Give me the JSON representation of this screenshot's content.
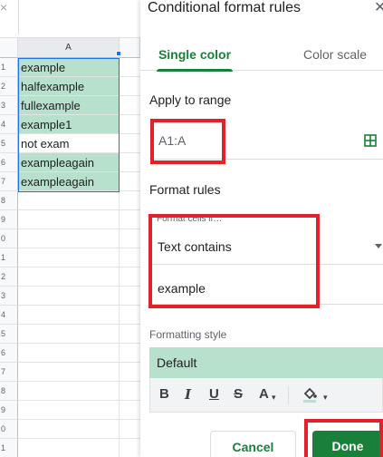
{
  "sheet": {
    "column_header": "A",
    "rows": [
      {
        "num": "1",
        "value": "example",
        "highlight": true
      },
      {
        "num": "2",
        "value": "halfexample",
        "highlight": true
      },
      {
        "num": "3",
        "value": "fullexample",
        "highlight": true
      },
      {
        "num": "4",
        "value": "example1",
        "highlight": true
      },
      {
        "num": "5",
        "value": "not exam",
        "highlight": false
      },
      {
        "num": "6",
        "value": "exampleagain",
        "highlight": true
      },
      {
        "num": "7",
        "value": "exampleagain",
        "highlight": true
      },
      {
        "num": "8",
        "value": "",
        "highlight": false
      },
      {
        "num": "9",
        "value": "",
        "highlight": false
      },
      {
        "num": "0",
        "value": "",
        "highlight": false
      },
      {
        "num": "1",
        "value": "",
        "highlight": false
      },
      {
        "num": "2",
        "value": "",
        "highlight": false
      },
      {
        "num": "3",
        "value": "",
        "highlight": false
      },
      {
        "num": "4",
        "value": "",
        "highlight": false
      },
      {
        "num": "5",
        "value": "",
        "highlight": false
      },
      {
        "num": "6",
        "value": "",
        "highlight": false
      },
      {
        "num": "7",
        "value": "",
        "highlight": false
      },
      {
        "num": "8",
        "value": "",
        "highlight": false
      },
      {
        "num": "9",
        "value": "",
        "highlight": false
      },
      {
        "num": "0",
        "value": "",
        "highlight": false
      },
      {
        "num": "1",
        "value": "",
        "highlight": false
      }
    ],
    "highlight_color": "#b7e1cd",
    "close_mark": "×"
  },
  "panel": {
    "title": "Conditional format rules",
    "close_icon": "close-icon",
    "tabs": [
      {
        "label": "Single color",
        "active": true
      },
      {
        "label": "Color scale",
        "active": false
      }
    ],
    "apply_to_range_label": "Apply to range",
    "range_value": "A1:A",
    "format_rules_label": "Format rules",
    "format_cells_if_label": "Format cells if…",
    "condition": "Text contains",
    "condition_value": "example",
    "formatting_style_label": "Formatting style",
    "style_preset": "Default",
    "toolbar": {
      "bold": "B",
      "italic": "I",
      "underline": "U",
      "strikethrough": "S",
      "text_color": "A",
      "caret": "▾"
    },
    "cancel_label": "Cancel",
    "done_label": "Done",
    "accent_color": "#188038",
    "annotation_color": "#e3212b"
  }
}
